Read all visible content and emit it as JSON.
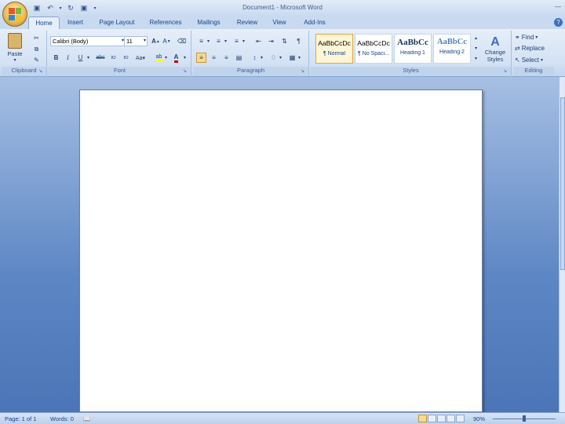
{
  "window": {
    "title": "Document1 - Microsoft Word"
  },
  "tabs": [
    "Home",
    "Insert",
    "Page Layout",
    "References",
    "Mailings",
    "Review",
    "View",
    "Add-Ins"
  ],
  "clipboard": {
    "paste_label": "Paste",
    "group_label": "Clipboard"
  },
  "font": {
    "name": "Calibri (Body)",
    "size": "11",
    "group_label": "Font",
    "color_accent": "#c00000",
    "highlight_accent": "#ffff00"
  },
  "paragraph": {
    "group_label": "Paragraph"
  },
  "styles": {
    "group_label": "Styles",
    "items": [
      {
        "sample": "AaBbCcDc",
        "name": "¶ Normal"
      },
      {
        "sample": "AaBbCcDc",
        "name": "¶ No Spaci..."
      },
      {
        "sample": "AaBbCc",
        "name": "Heading 1"
      },
      {
        "sample": "AaBbCc",
        "name": "Heading 2"
      }
    ],
    "change_label_1": "Change",
    "change_label_2": "Styles"
  },
  "editing": {
    "group_label": "Editing",
    "find": "Find",
    "replace": "Replace",
    "select": "Select"
  },
  "status": {
    "page": "Page: 1 of 1",
    "words": "Words: 0",
    "zoom": "90%"
  }
}
